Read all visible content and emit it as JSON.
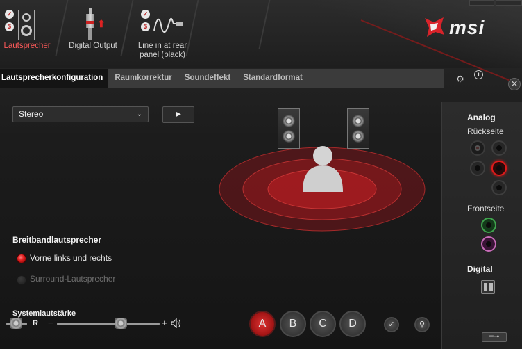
{
  "devices": [
    {
      "label": "Lautsprecher",
      "active": true
    },
    {
      "label": "Digital Output",
      "active": false
    },
    {
      "label": "Line in at rear\npanel (black)",
      "active": false
    }
  ],
  "brand": "msi",
  "tabs": [
    {
      "label": "Lautsprecherkonfiguration",
      "active": true
    },
    {
      "label": "Raumkorrektur",
      "active": false
    },
    {
      "label": "Soundeffekt",
      "active": false
    },
    {
      "label": "Standardformat",
      "active": false
    }
  ],
  "config": {
    "selected": "Stereo",
    "play_icon": "▶"
  },
  "broadband": {
    "title": "Breitbandlautsprecher",
    "options": [
      {
        "label": "Vorne links und rechts",
        "checked": true
      },
      {
        "label": "Surround-Lautsprecher",
        "checked": false
      }
    ]
  },
  "volume": {
    "title": "Systemlautstärke",
    "balance_right_label": "R",
    "minus": "−",
    "plus": "+",
    "level": 0.6
  },
  "presets": [
    "A",
    "B",
    "C",
    "D"
  ],
  "active_preset": "A",
  "right_panel": {
    "analog_title": "Analog",
    "rear_label": "Rückseite",
    "front_label": "Frontseite",
    "digital_title": "Digital"
  },
  "colors": {
    "accent": "#d8232a",
    "jack_red": "#e01a1a",
    "jack_green": "#3fa34d",
    "jack_pink": "#c76bb8"
  },
  "icons": {
    "speaker": "speaker-icon",
    "mute": "volume-icon",
    "gear": "gear-icon",
    "info": "info-icon",
    "close": "close-icon",
    "wrench": "wrench-icon"
  }
}
